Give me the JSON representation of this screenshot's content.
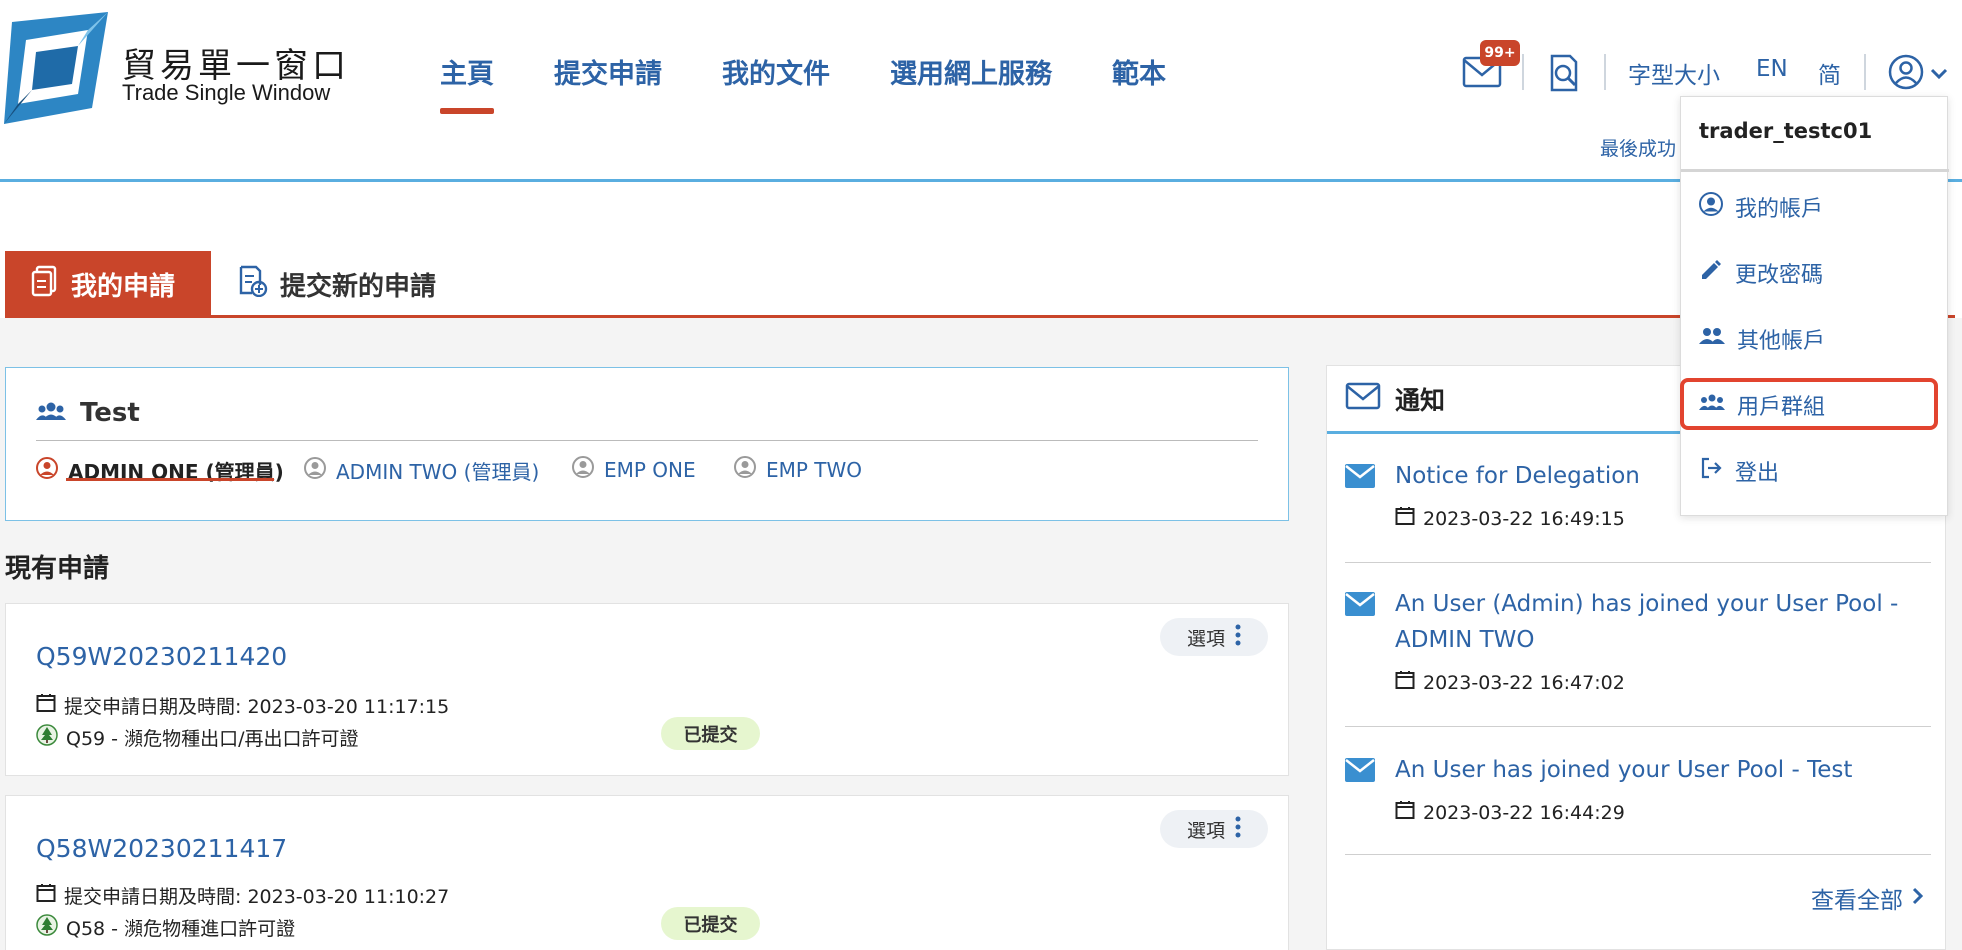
{
  "header": {
    "logo_zh": "貿易單一窗口",
    "logo_en": "Trade Single Window",
    "nav": [
      "主頁",
      "提交申請",
      "我的文件",
      "選用網上服務",
      "範本"
    ],
    "active_nav": "主頁",
    "mail_badge": "99+",
    "font_size_label": "字型大小",
    "lang_en": "EN",
    "lang_sc": "简",
    "last_login_prefix": "最後成功"
  },
  "user_menu": {
    "username": "trader_testc01",
    "items": [
      {
        "label": "我的帳戶",
        "icon": "user-circle-icon"
      },
      {
        "label": "更改密碼",
        "icon": "pencil-icon"
      },
      {
        "label": "其他帳戶",
        "icon": "users-icon"
      },
      {
        "label": "用戶群組",
        "icon": "users-icon"
      },
      {
        "label": "登出",
        "icon": "logout-icon"
      }
    ],
    "highlighted": "用戶群組"
  },
  "tabs": {
    "my_apps": "我的申請",
    "new_app": "提交新的申請"
  },
  "user_pool": {
    "name": "Test",
    "members": [
      "ADMIN ONE (管理員)",
      "ADMIN TWO (管理員)",
      "EMP ONE",
      "EMP TWO"
    ],
    "active_member": "ADMIN ONE (管理員)"
  },
  "current_apps_title": "現有申請",
  "applications": [
    {
      "id": "Q59W20230211420",
      "options_label": "選項",
      "date_label": "提交申請日期及時間: 2023-03-20 11:17:15",
      "type": "Q59 - 瀕危物種出口/再出口許可證",
      "status": "已提交"
    },
    {
      "id": "Q58W20230211417",
      "options_label": "選項",
      "date_label": "提交申請日期及時間: 2023-03-20 11:10:27",
      "type": "Q58 - 瀕危物種進口許可證",
      "status": "已提交"
    }
  ],
  "notifications": {
    "title": "通知",
    "items": [
      {
        "title": "Notice for Delegation",
        "date": "2023-03-22 16:49:15"
      },
      {
        "title": "An User (Admin) has joined your User Pool - ADMIN TWO",
        "date": "2023-03-22 16:47:02"
      },
      {
        "title": "An User has joined your User Pool - Test",
        "date": "2023-03-22 16:44:29"
      }
    ],
    "view_all": "查看全部"
  },
  "colors": {
    "brand_blue": "#2d63a6",
    "accent_red": "#c9452a",
    "header_line": "#5aaee0",
    "status_green_bg": "#e6f6cf"
  }
}
